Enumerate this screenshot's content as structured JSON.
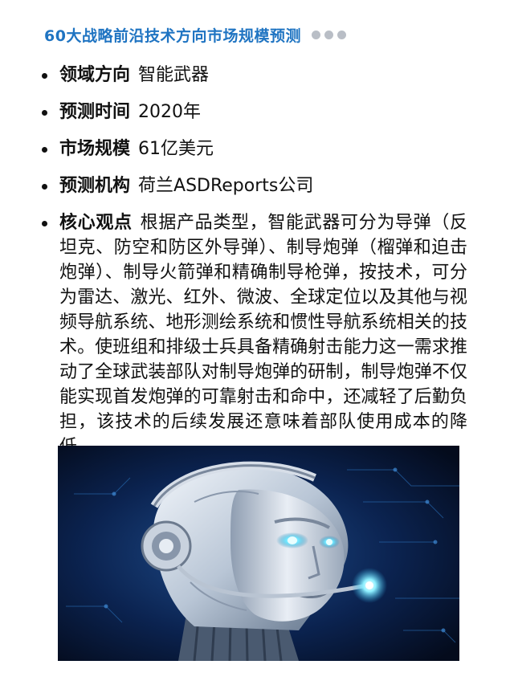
{
  "header": {
    "title": "60大战略前沿技术方向市场规模预测"
  },
  "items": [
    {
      "label": "领域方向",
      "value": "智能武器"
    },
    {
      "label": "预测时间",
      "value": "2020年"
    },
    {
      "label": "市场规模",
      "value": "61亿美元"
    },
    {
      "label": "预测机构",
      "value": "荷兰ASDReports公司"
    },
    {
      "label": "核心观点",
      "value": "根据产品类型，智能武器可分为导弹（反坦克、防空和防区外导弹）、制导炮弹（榴弹和迫击炮弹）、制导火箭弹和精确制导枪弹，按技术，可分为雷达、激光、红外、微波、全球定位以及其他与视频导航系统、地形测绘系统和惯性导航系统相关的技术。使班组和排级士兵具备精确射击能力这一需求推动了全球武装部队对制导炮弹的研制，制导炮弹不仅能实现首发炮弹的可靠射击和命中，还减轻了后勤负担，该技术的后续发展还意味着部队使用成本的降低。"
    }
  ],
  "colors": {
    "title_blue": "#1f74c2",
    "dot_gray": "#b9bec6",
    "image_bg": "#06122a"
  },
  "image": {
    "subject": "robot-head-with-headset"
  }
}
